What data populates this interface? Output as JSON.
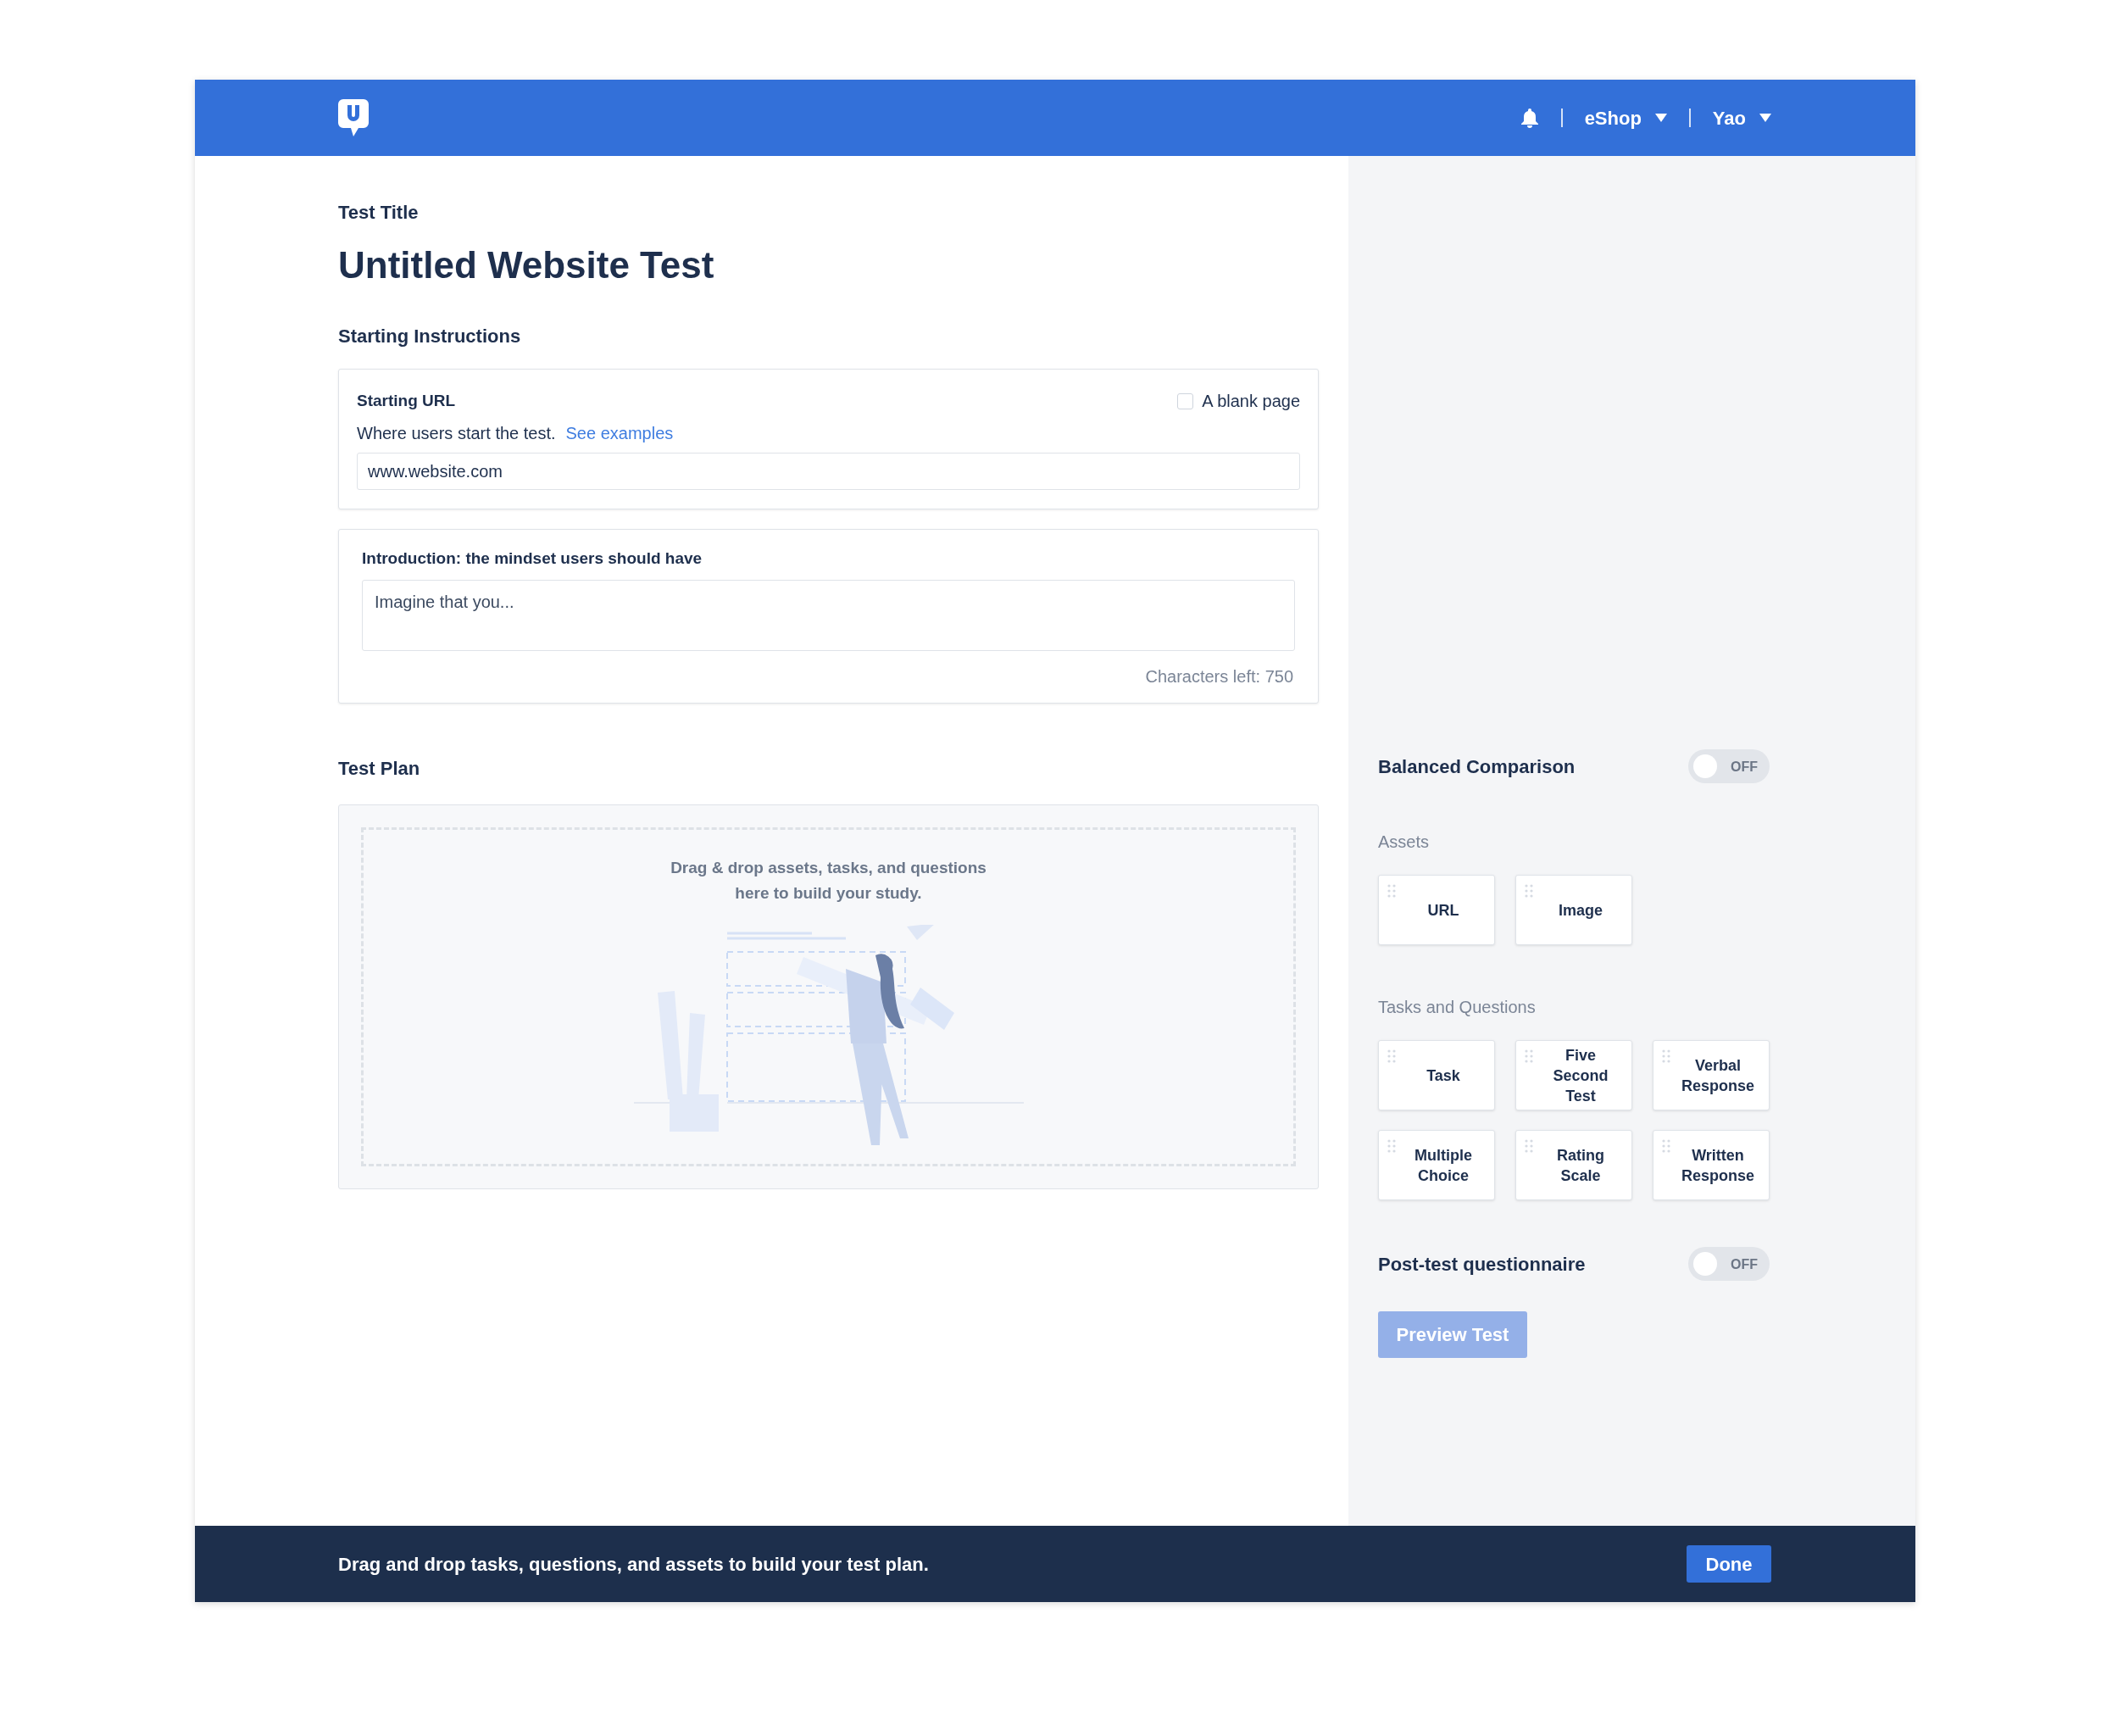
{
  "header": {
    "menus": [
      {
        "label": "eShop"
      },
      {
        "label": "Yao"
      }
    ]
  },
  "test_title": {
    "label": "Test Title",
    "value": "Untitled Website Test"
  },
  "starting_instructions": {
    "heading": "Starting Instructions",
    "starting_url": {
      "label": "Starting URL",
      "blank_page": {
        "label": "A blank page",
        "checked": false
      },
      "help": "Where users start the test.",
      "link": "See examples",
      "value": "www.website.com"
    },
    "introduction": {
      "label": "Introduction: the mindset users should have",
      "placeholder": "Imagine that you...",
      "counter": "Characters left: 750"
    }
  },
  "test_plan": {
    "heading": "Test Plan",
    "hint": "Drag & drop assets, tasks, and questions here to build your study."
  },
  "sidebar": {
    "balanced_comparison": {
      "label": "Balanced Comparison",
      "on": false,
      "state_text": "OFF"
    },
    "assets": {
      "heading": "Assets",
      "items": [
        "URL",
        "Image"
      ]
    },
    "tasks_and_questions": {
      "heading": "Tasks and Questions",
      "items": [
        "Task",
        "Five Second Test",
        "Verbal Response",
        "Multiple Choice",
        "Rating Scale",
        "Written Response"
      ]
    },
    "post_test_questionnaire": {
      "label": "Post-test questionnaire",
      "on": false,
      "state_text": "OFF"
    },
    "preview_button": {
      "label": "Preview Test",
      "disabled": true
    }
  },
  "footer": {
    "message": "Drag and drop tasks, questions, and assets to build your test plan.",
    "button": "Done"
  }
}
